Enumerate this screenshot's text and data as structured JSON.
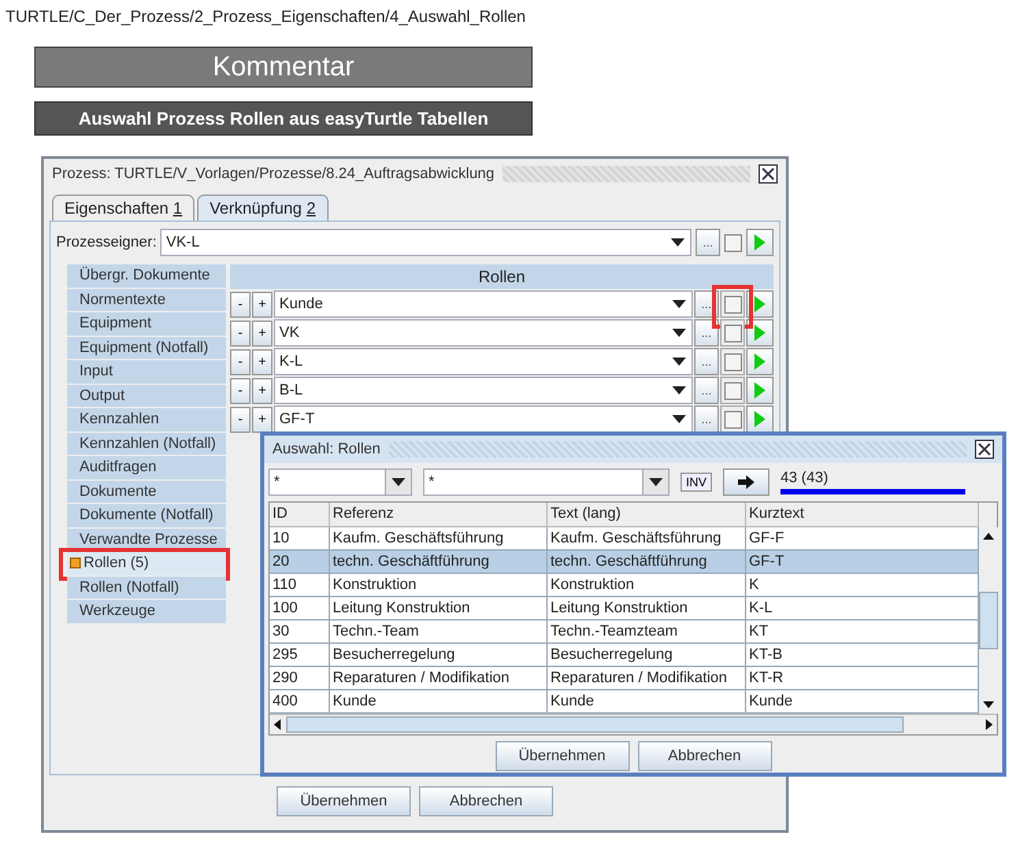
{
  "breadcrumb": "TURTLE/C_Der_Prozess/2_Prozess_Eigenschaften/4_Auswahl_Rollen",
  "banner": "Kommentar",
  "subtitle": "Auswahl Prozess Rollen aus easyTurtle Tabellen",
  "window": {
    "title": "Prozess: TURTLE/V_Vorlagen/Prozesse/8.24_Auftragsabwicklung"
  },
  "tabs": [
    {
      "label": "Eigenschaften",
      "mnemonic": "1",
      "selected": false
    },
    {
      "label": "Verknüpfung",
      "mnemonic": "2",
      "selected": true
    }
  ],
  "owner": {
    "label": "Prozesseigner:",
    "value": "VK-L",
    "browse": "...",
    "checked": false
  },
  "sidebar": {
    "items": [
      {
        "label": "Übergr. Dokumente",
        "selected": false,
        "highlighted": false
      },
      {
        "label": "Normentexte",
        "selected": false,
        "highlighted": false
      },
      {
        "label": "Equipment",
        "selected": false,
        "highlighted": false
      },
      {
        "label": "Equipment (Notfall)",
        "selected": false,
        "highlighted": false
      },
      {
        "label": "Input",
        "selected": false,
        "highlighted": false
      },
      {
        "label": "Output",
        "selected": false,
        "highlighted": false
      },
      {
        "label": "Kennzahlen",
        "selected": false,
        "highlighted": false
      },
      {
        "label": "Kennzahlen (Notfall)",
        "selected": false,
        "highlighted": false
      },
      {
        "label": "Auditfragen",
        "selected": false,
        "highlighted": false
      },
      {
        "label": "Dokumente",
        "selected": false,
        "highlighted": false
      },
      {
        "label": "Dokumente (Notfall)",
        "selected": false,
        "highlighted": false
      },
      {
        "label": "Verwandte Prozesse",
        "selected": false,
        "highlighted": false
      },
      {
        "label": "Rollen (5)",
        "selected": true,
        "highlighted": true
      },
      {
        "label": "Rollen (Notfall)",
        "selected": false,
        "highlighted": false
      },
      {
        "label": "Werkzeuge",
        "selected": false,
        "highlighted": false
      }
    ]
  },
  "roles": {
    "header": "Rollen",
    "rows": [
      {
        "minus": "-",
        "plus": "+",
        "value": "Kunde",
        "browse": "...",
        "checked": false,
        "highlighted": true
      },
      {
        "minus": "-",
        "plus": "+",
        "value": "VK",
        "browse": "...",
        "checked": false,
        "highlighted": false
      },
      {
        "minus": "-",
        "plus": "+",
        "value": "K-L",
        "browse": "...",
        "checked": false,
        "highlighted": false
      },
      {
        "minus": "-",
        "plus": "+",
        "value": "B-L",
        "browse": "...",
        "checked": false,
        "highlighted": false
      },
      {
        "minus": "-",
        "plus": "+",
        "value": "GF-T",
        "browse": "...",
        "checked": false,
        "highlighted": false
      }
    ]
  },
  "buttons": [
    "Übernehmen",
    "Abbrechen"
  ],
  "dialog": {
    "title": "Auswahl: Rollen",
    "filter_1": "*",
    "filter_2": "*",
    "inv": "INV",
    "count": "43 (43)",
    "level": 1,
    "table": {
      "columns": [
        "ID",
        "Referenz",
        "Text (lang)",
        "Kurztext"
      ],
      "rows": [
        {
          "cells": [
            "10",
            "Kaufm. Geschäftsführung",
            "Kaufm. Geschäftsführung",
            "GF-F"
          ],
          "selected": false
        },
        {
          "cells": [
            "20",
            "techn. Geschäftführung",
            "techn. Geschäftführung",
            "GF-T"
          ],
          "selected": true
        },
        {
          "cells": [
            "110",
            "Konstruktion",
            "Konstruktion",
            "K"
          ],
          "selected": false
        },
        {
          "cells": [
            "100",
            "Leitung Konstruktion",
            "Leitung Konstruktion",
            "K-L"
          ],
          "selected": false
        },
        {
          "cells": [
            "30",
            "Techn.-Team",
            "Techn.-Teamzteam",
            "KT"
          ],
          "selected": false
        },
        {
          "cells": [
            "295",
            "Besucherregelung",
            "Besucherregelung",
            "KT-B"
          ],
          "selected": false
        },
        {
          "cells": [
            "290",
            "Reparaturen / Modifikation",
            "Reparaturen / Modifikation",
            "KT-R"
          ],
          "selected": false
        },
        {
          "cells": [
            "400",
            "Kunde",
            "Kunde",
            "Kunde"
          ],
          "selected": false
        }
      ]
    },
    "buttons": [
      "Übernehmen",
      "Abbrechen"
    ]
  }
}
